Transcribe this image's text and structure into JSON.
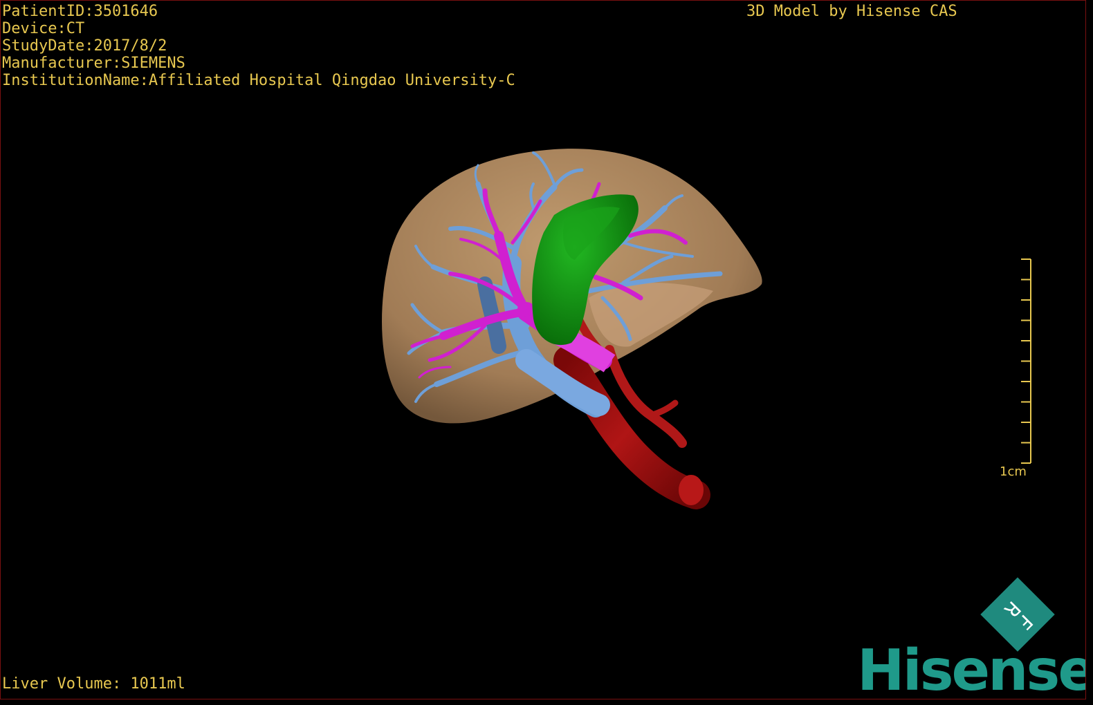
{
  "info": {
    "patient_id": "PatientID:3501646",
    "device": "Device:CT",
    "study_date": "StudyDate:2017/8/2",
    "manufacturer": "Manufacturer:SIEMENS",
    "institution": "InstitutionName:Affiliated Hospital Qingdao University-C"
  },
  "model_credit": "3D Model by Hisense CAS",
  "liver_volume": "Liver Volume: 1011ml",
  "scale": {
    "label": "1cm",
    "ticks": 10
  },
  "logo": {
    "badge": "RF",
    "brand": "Hisense"
  },
  "colors": {
    "overlay_text": "#e8c850",
    "liver": "#b58a5e",
    "tumor": "#0a8a0a",
    "portal_vein": "#6e9fd8",
    "hepatic_vein": "#d020d0",
    "artery": "#a01010",
    "brand": "#1f9a8a"
  }
}
